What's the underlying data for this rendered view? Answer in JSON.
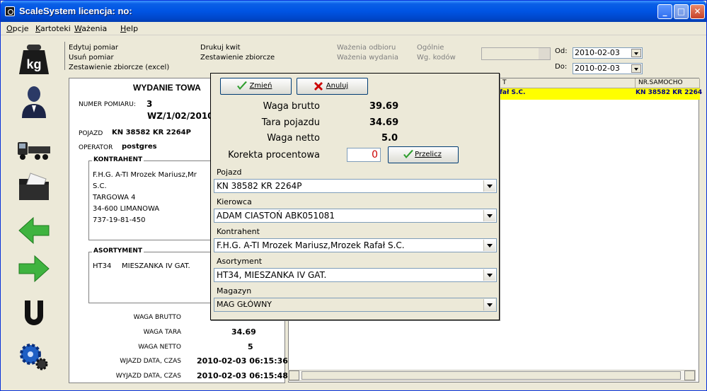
{
  "window": {
    "title": "ScaleSystem licencja:  no:",
    "controls": {
      "minimize": "_",
      "maximize": "□",
      "close": "✕"
    }
  },
  "menu": [
    "Opcje",
    "Kartoteki",
    "Ważenia",
    "Help"
  ],
  "toolbar_icons": [
    "weight-kg-icon",
    "operator-icon",
    "truck-icon",
    "folder-icon",
    "arrow-left-icon",
    "arrow-right-icon",
    "magnet-icon",
    "gear-icon"
  ],
  "actions": {
    "col1": [
      "Edytuj pomiar",
      "Usuń pomiar",
      "Zestawienie zbiorcze (excel)"
    ],
    "col2": [
      "Drukuj kwit",
      "Zestawienie zbiorcze"
    ],
    "col3": [
      "Ważenia odbioru",
      "Ważenia wydania"
    ],
    "col4": [
      "Ogólnie",
      "Wg. kodów"
    ]
  },
  "filters": {
    "od_label": "Od:",
    "od_value": "2010-02-03",
    "do_label": "Do:",
    "do_value": "2010-02-03"
  },
  "document": {
    "title": "WYDANIE TOWA",
    "numer_label": "NUMER POMIARU:",
    "numer_value": "3",
    "wz": "WZ/1/02/2010",
    "pojazd_label": "POJAZD",
    "pojazd_value": "KN 38582 KR 2264P",
    "operator_label": "OPERATOR",
    "operator_value": "postgres",
    "kontrahent_caption": "KONTRAHENT",
    "kontrahent_lines": [
      "F.H.G.  A-TI  Mrozek Mariusz,Mr",
      "S.C.",
      "TARGOWA  4",
      "34-600 LIMANOWA",
      "737-19-81-450"
    ],
    "asortyment_caption": "ASORTYMENT",
    "asortyment_code": "HT34",
    "asortyment_name": "MIESZANKA IV GAT.",
    "summary": [
      {
        "label": "WAGA BRUTTO",
        "value": ""
      },
      {
        "label": "WAGA TARA",
        "value": "34.69"
      },
      {
        "label": "WAGA NETTO",
        "value": "5"
      },
      {
        "label": "WJAZD DATA, CZAS",
        "value": "2010-02-03 06:15:36"
      },
      {
        "label": "WYJAZD DATA, CZAS",
        "value": "2010-02-03 06:15:48"
      }
    ]
  },
  "table": {
    "headers": [
      "T",
      "NR.SAMOCHO"
    ],
    "row": [
      "fał S.C.",
      "KN 38582 KR 2264"
    ]
  },
  "dialog": {
    "btn_change": "Zmień",
    "btn_cancel": "Anuluj",
    "waga_brutto_label": "Waga brutto",
    "waga_brutto_value": "39.69",
    "tara_label": "Tara pojazdu",
    "tara_value": "34.69",
    "netto_label": "Waga netto",
    "netto_value": "5.0",
    "korekta_label": "Korekta procentowa",
    "korekta_value": "0",
    "btn_recalc": "Przelicz",
    "fields": [
      {
        "label": "Pojazd",
        "value": "KN 38582 KR 2264P"
      },
      {
        "label": "Kierowca",
        "value": "ADAM CIASTOŃ ABK051081"
      },
      {
        "label": "Kontrahent",
        "value": "F.H.G.  A-TI  Mrozek Mariusz,Mrozek Rafał S.C."
      },
      {
        "label": "Asortyment",
        "value": "HT34, MIESZANKA IV GAT."
      },
      {
        "label": "Magazyn",
        "value": "MAG GŁÓWNY"
      }
    ]
  },
  "colors": {
    "titlebar": "#0054e3",
    "selection": "#ffff00",
    "accent_green": "#2e9e2e",
    "error_red": "#cc0000"
  }
}
